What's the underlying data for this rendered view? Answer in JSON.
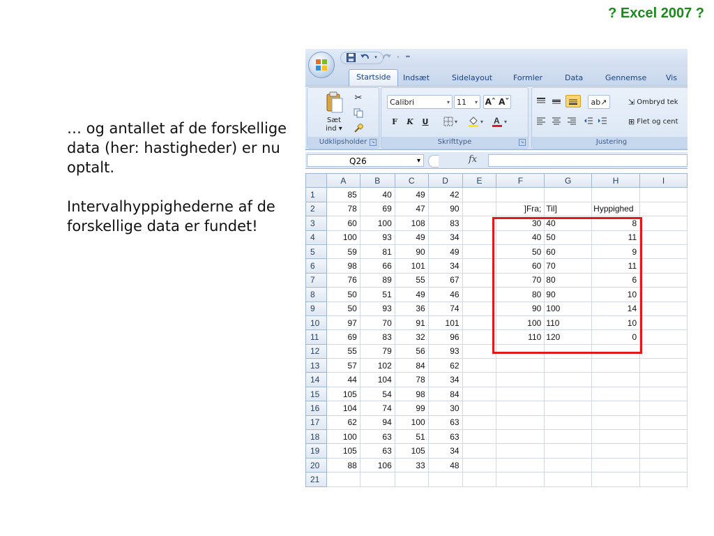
{
  "slide": {
    "title": "? Excel 2007 ?",
    "paragraphs": [
      "… og antallet af de forskellige data (her: hastigheder) er nu optalt.",
      "Intervalhyppighederne af de forskellige data er fundet!"
    ]
  },
  "ribbon": {
    "tabs": [
      "Startside",
      "Indsæt",
      "Sidelayout",
      "Formler",
      "Data",
      "Gennemse",
      "Vis"
    ],
    "clipboard": {
      "paste_label_1": "Sæt",
      "paste_label_2": "ind ▾",
      "group_label": "Udklipsholder"
    },
    "font": {
      "name": "Calibri",
      "size": "11",
      "bold": "F",
      "italic": "K",
      "underline": "U",
      "group_label": "Skrifttype"
    },
    "alignment": {
      "wrap_text": "Ombryd tek",
      "merge_center": "Flet og cent",
      "group_label": "Justering"
    }
  },
  "formula_bar": {
    "name_box": "Q26",
    "fx": "fx",
    "content": ""
  },
  "sheet": {
    "columns": [
      "A",
      "B",
      "C",
      "D",
      "E",
      "F",
      "G",
      "H",
      "I"
    ],
    "rows": [
      [
        "85",
        "40",
        "49",
        "42",
        "",
        "",
        "",
        "",
        ""
      ],
      [
        "78",
        "69",
        "47",
        "90",
        "",
        "]Fra;",
        "Til]",
        "Hyppighed",
        ""
      ],
      [
        "60",
        "100",
        "108",
        "83",
        "",
        "30",
        "40",
        "8",
        ""
      ],
      [
        "100",
        "93",
        "49",
        "34",
        "",
        "40",
        "50",
        "11",
        ""
      ],
      [
        "59",
        "81",
        "90",
        "49",
        "",
        "50",
        "60",
        "9",
        ""
      ],
      [
        "98",
        "66",
        "101",
        "34",
        "",
        "60",
        "70",
        "11",
        ""
      ],
      [
        "76",
        "89",
        "55",
        "67",
        "",
        "70",
        "80",
        "6",
        ""
      ],
      [
        "50",
        "51",
        "49",
        "46",
        "",
        "80",
        "90",
        "10",
        ""
      ],
      [
        "50",
        "93",
        "36",
        "74",
        "",
        "90",
        "100",
        "14",
        ""
      ],
      [
        "97",
        "70",
        "91",
        "101",
        "",
        "100",
        "110",
        "10",
        ""
      ],
      [
        "69",
        "83",
        "32",
        "96",
        "",
        "110",
        "120",
        "0",
        ""
      ],
      [
        "55",
        "79",
        "56",
        "93",
        "",
        "",
        "",
        "",
        ""
      ],
      [
        "57",
        "102",
        "84",
        "62",
        "",
        "",
        "",
        "",
        ""
      ],
      [
        "44",
        "104",
        "78",
        "34",
        "",
        "",
        "",
        "",
        ""
      ],
      [
        "105",
        "54",
        "98",
        "84",
        "",
        "",
        "",
        "",
        ""
      ],
      [
        "104",
        "74",
        "99",
        "30",
        "",
        "",
        "",
        "",
        ""
      ],
      [
        "62",
        "94",
        "100",
        "63",
        "",
        "",
        "",
        "",
        ""
      ],
      [
        "100",
        "63",
        "51",
        "63",
        "",
        "",
        "",
        "",
        ""
      ],
      [
        "105",
        "63",
        "105",
        "34",
        "",
        "",
        "",
        "",
        ""
      ],
      [
        "88",
        "106",
        "33",
        "48",
        "",
        "",
        "",
        "",
        ""
      ],
      [
        "",
        "",
        "",
        "",
        "",
        "",
        "",
        "",
        ""
      ]
    ],
    "left_aligned": {
      "rows": [
        1
      ],
      "cols": [
        7
      ]
    },
    "text_left_col": 6
  },
  "colors": {
    "title_green": "#1a8a1a",
    "highlight_red": "#e0191a",
    "ribbon_blue": "#15428b"
  }
}
